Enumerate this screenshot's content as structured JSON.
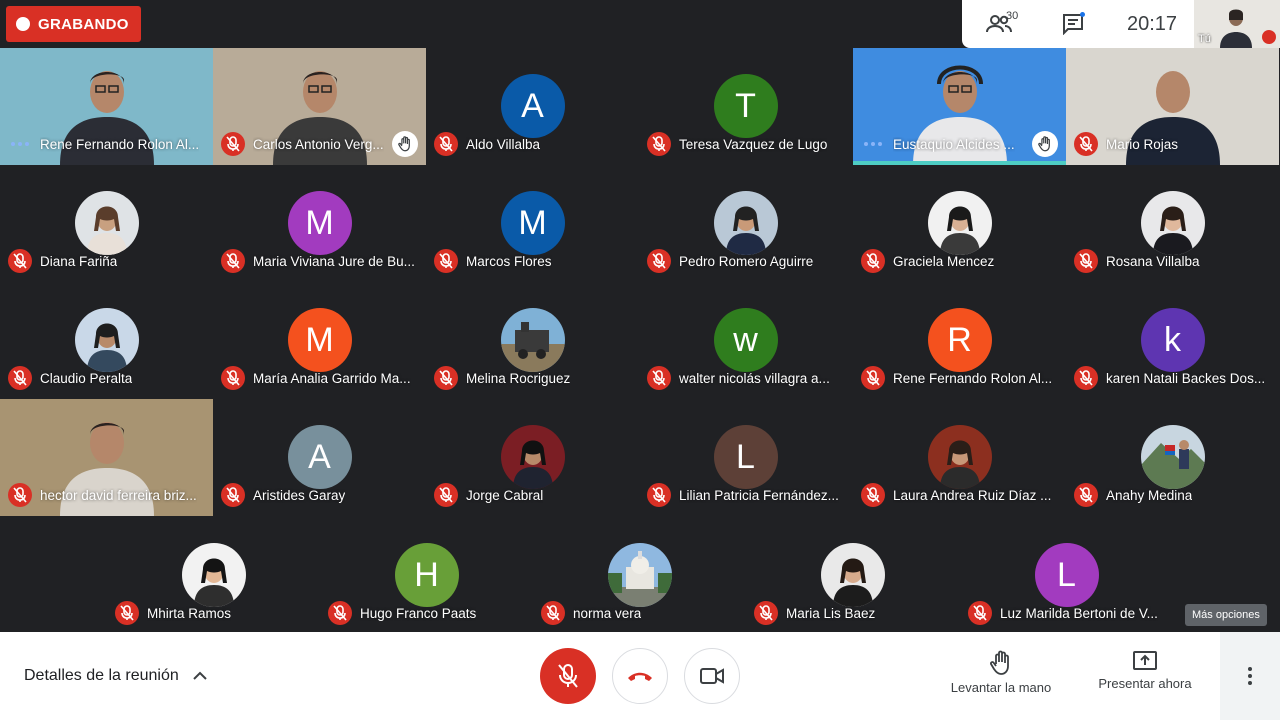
{
  "recording": {
    "label": "GRABANDO"
  },
  "header": {
    "people_count": "30",
    "clock": "20:17",
    "self_label": "Tú"
  },
  "colors": {
    "recording_red": "#d93025",
    "meet_dark": "#202124",
    "speaking_teal": "#4ecdc4"
  },
  "participants": [
    {
      "name": "Rene Fernando Rolon Al...",
      "status": "speaking-dots",
      "tile": "video-man-tie",
      "bg": "#7fb8c9"
    },
    {
      "name": "Carlos Antonio Verg...",
      "status": "mic-off",
      "tile": "video-man-glasses",
      "bg": "#b8ab98",
      "hand": true
    },
    {
      "name": "Aldo Villalba",
      "status": "mic-off",
      "initial": "A",
      "avatar_color": "#0a5aa8"
    },
    {
      "name": "Teresa Vazquez de Lugo",
      "status": "mic-off",
      "initial": "T",
      "avatar_color": "#2f7d1e"
    },
    {
      "name": "Eustaquio Alcides ...",
      "status": "speaking-dots",
      "tile": "video-man-headset",
      "bg": "#3f8ce0",
      "hand": true,
      "speaking_bar": true
    },
    {
      "name": "Mario Rojas",
      "status": "mic-off",
      "tile": "video-man-bald",
      "bg": "#d9d6cf"
    },
    {
      "name": "Diana Fariña",
      "status": "mic-off",
      "photo": "woman-light"
    },
    {
      "name": "Maria Viviana Jure de Bu...",
      "status": "mic-off",
      "initial": "M",
      "avatar_color": "#a23bbf"
    },
    {
      "name": "Marcos Flores",
      "status": "mic-off",
      "initial": "M",
      "avatar_color": "#0a5aa8"
    },
    {
      "name": "Pedro Romero Aguirre",
      "status": "mic-off",
      "photo": "man-suit"
    },
    {
      "name": "Graciela Mencez",
      "status": "mic-off",
      "photo": "woman-dark"
    },
    {
      "name": "Rosana Villalba",
      "status": "mic-off",
      "photo": "woman-blazer"
    },
    {
      "name": "Claudio Peralta",
      "status": "mic-off",
      "photo": "man-blue"
    },
    {
      "name": "María Analia Garrido Ma...",
      "status": "mic-off",
      "initial": "M",
      "avatar_color": "#f4511e"
    },
    {
      "name": "Melina Rocriguez",
      "status": "mic-off",
      "photo": "landscape-train"
    },
    {
      "name": "walter nicolás villagra a...",
      "status": "mic-off",
      "initial": "w",
      "avatar_color": "#2f7d1e"
    },
    {
      "name": "Rene Fernando Rolon Al...",
      "status": "mic-off",
      "initial": "R",
      "avatar_color": "#f4511e"
    },
    {
      "name": "karen Natali Backes Dos...",
      "status": "mic-off",
      "initial": "k",
      "avatar_color": "#5e35b1"
    },
    {
      "name": "hector david ferreira briz...",
      "status": "mic-off",
      "tile": "video-man-room",
      "bg": "#a89472"
    },
    {
      "name": "Aristides Garay",
      "status": "mic-off",
      "initial": "A",
      "avatar_color": "#78909c"
    },
    {
      "name": "Jorge Cabral",
      "status": "mic-off",
      "photo": "man-flags"
    },
    {
      "name": "Lilian Patricia Fernández...",
      "status": "mic-off",
      "initial": "L",
      "avatar_color": "#5d4037"
    },
    {
      "name": "Laura Andrea Ruiz Díaz ...",
      "status": "mic-off",
      "photo": "woman-podium"
    },
    {
      "name": "Anahy Medina",
      "status": "mic-off",
      "photo": "mountain-woman"
    },
    {
      "name": "Mhirta Ramos",
      "status": "mic-off",
      "photo": "woman-glasses"
    },
    {
      "name": "Hugo Franco Paats",
      "status": "mic-off",
      "initial": "H",
      "avatar_color": "#689f38"
    },
    {
      "name": "norma vera",
      "status": "mic-off",
      "photo": "church"
    },
    {
      "name": "Maria Lis Baez",
      "status": "mic-off",
      "photo": "woman-formal"
    },
    {
      "name": "Luz Marilda Bertoni de V...",
      "status": "mic-off",
      "initial": "L",
      "avatar_color": "#a23bbf"
    }
  ],
  "bottom": {
    "details_label": "Detalles de la reunión",
    "raise_hand_label": "Levantar la mano",
    "present_label": "Presentar ahora",
    "tooltip": "Más opciones"
  }
}
